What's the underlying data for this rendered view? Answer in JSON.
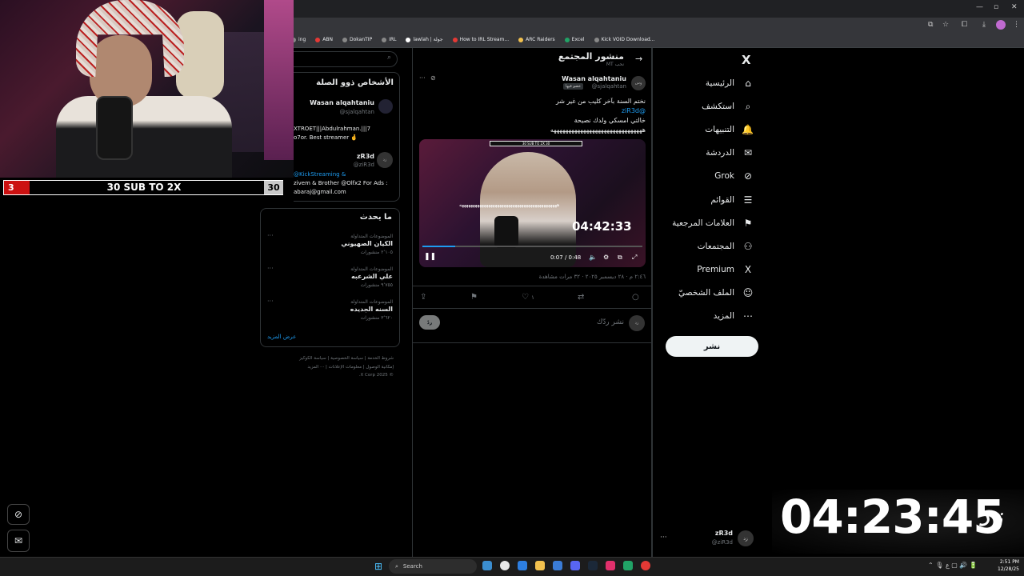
{
  "bookmarks": [
    {
      "label": "ing",
      "color": "#888"
    },
    {
      "label": "ABN",
      "color": "#e53935"
    },
    {
      "label": "DokanTIP",
      "color": "#888"
    },
    {
      "label": "IRL",
      "color": "#888"
    },
    {
      "label": "lawlah | جولة",
      "color": "#fff"
    },
    {
      "label": "How to IRL Stream...",
      "color": "#e53935"
    },
    {
      "label": "ARC Raiders",
      "color": "#f2c14e"
    },
    {
      "label": "Excel",
      "color": "#21a366"
    },
    {
      "label": "Kick VOID Download...",
      "color": "#888"
    }
  ],
  "nav": {
    "logo": "X",
    "items": [
      {
        "label": "الرئيسية",
        "icon": "⌂"
      },
      {
        "label": "استكشف",
        "icon": "⌕"
      },
      {
        "label": "التنبيهات",
        "icon": "🔔"
      },
      {
        "label": "الدردشة",
        "icon": "✉"
      },
      {
        "label": "Grok",
        "icon": "⊘"
      },
      {
        "label": "القوائم",
        "icon": "☰"
      },
      {
        "label": "العلامات المرجعية",
        "icon": "⚑"
      },
      {
        "label": "المجتمعات",
        "icon": "⚇"
      },
      {
        "label": "Premium",
        "icon": "X"
      },
      {
        "label": "الملف الشخصيّ",
        "icon": "☺"
      },
      {
        "label": "المزيد",
        "icon": "⋯"
      }
    ],
    "post_button": "نشر",
    "account": {
      "name": "zR3d",
      "handle": "@ziR3d",
      "avatar": "زد",
      "more": "···"
    }
  },
  "post": {
    "header_title": "منشور المجتمع",
    "header_sub": "MT ‏نحب",
    "author_name": "Wasan alqahtaniu",
    "author_handle": "@sjalqahtan",
    "badge": "عضو فيها",
    "avatar": "وس",
    "lines": [
      "نختم السنة بآخر كليب من غير شر",
      "@ziR3d",
      "خالتي امسكي ولدك نصيحة",
      "هههههههههههههههههههههههههههههههه"
    ],
    "video": {
      "banner": "30 SUB TO 2X          30",
      "timer": "04:42:33",
      "subtitle": "ههههههههههههههههههههههههههههههههههههههههههههه",
      "current_time": "0:07 / 0:48",
      "progress": 0.15
    },
    "meta": "٢:٤٦ م · ٢٨ ديسمبر ٢٠٢٥ · ٣٢ مرات مشاهدة",
    "actions": {
      "share": "⇪",
      "bookmark": "⚑",
      "likes": "١",
      "repost": "⇄",
      "reply": "○"
    },
    "reply_placeholder": "نشر ردّك",
    "reply_button": "ردّ",
    "reply_avatar": "زد"
  },
  "right": {
    "who_title": "الأشخاص ذوو الصلة",
    "who": [
      {
        "name": "Wasan alqahtaniu",
        "handle": "@sjalqahtan",
        "bio": [
          "XTROET|||Abdulrahman.|||7",
          "o7or. Best streamer 🤞"
        ]
      },
      {
        "name": "zR3d",
        "handle": "@ziR3d",
        "avatar": "زد",
        "bio": [
          "@KickStreaming &",
          "zivem & Brother @Olfx2 For Ads :",
          "abaraj@gmail.com"
        ]
      }
    ],
    "trends_title": "ما يحدث",
    "trends": [
      {
        "category": "الموضوعات المتداولة",
        "name": "الكيان الصهيوني",
        "count": "٢٬١٠٥ منشورات"
      },
      {
        "category": "الموضوعات المتداولة",
        "name": "علي الشرعبه",
        "count": "٩٬٧٥٥ منشورات"
      },
      {
        "category": "الموضوعات المتداولة",
        "name": "السنه الجديده",
        "count": "٣٬٦٢٠ منشورات"
      }
    ],
    "show_more": "عرض المزيد",
    "footer": [
      "شروط الخدمة | سياسة الخصوصية | سياسة الكوكيز",
      "إمكانية الوصول | معلومات الإعلانات | ··· المزيد",
      "© 2025 X Corp."
    ]
  },
  "overlay": {
    "sub_left": "3",
    "sub_text": "30 SUB TO 2X",
    "sub_right": "30",
    "stream_timer": "04:23:45",
    "stream_logo": "زد"
  },
  "taskbar": {
    "search": "Search",
    "time": "2:51 PM",
    "date": "12/28/25",
    "tray": "⌃  🎙  ع  ▢  🔊  🔋"
  }
}
